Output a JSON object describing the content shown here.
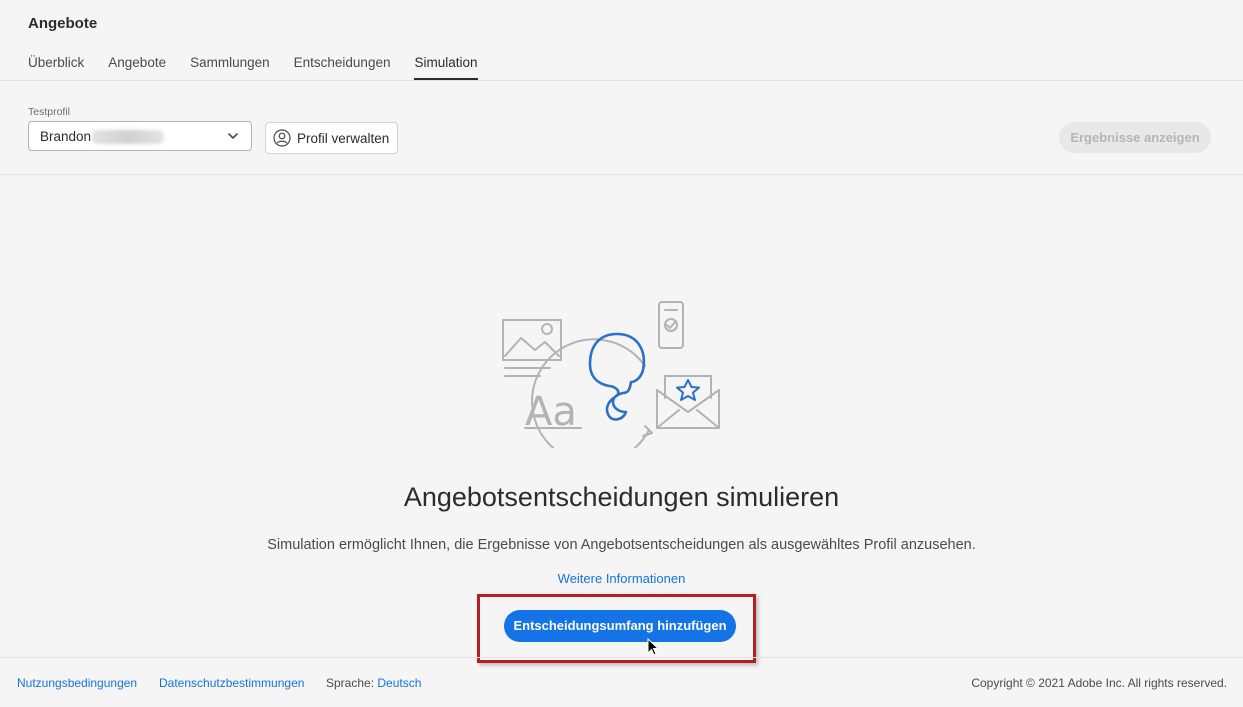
{
  "app": {
    "title": "Angebote"
  },
  "tabs": [
    {
      "label": "Überblick"
    },
    {
      "label": "Angebote"
    },
    {
      "label": "Sammlungen"
    },
    {
      "label": "Entscheidungen"
    },
    {
      "label": "Simulation",
      "active": true
    }
  ],
  "toolbar": {
    "profile_label": "Testprofil",
    "profile_value": "Brandon",
    "manage_label": "Profil verwalten",
    "results_label": "Ergebnisse anzeigen"
  },
  "main": {
    "title": "Angebotsentscheidungen simulieren",
    "description": "Simulation ermöglicht Ihnen, die Ergebnisse von Angebotsentscheidungen als ausgewähltes Profil anzusehen.",
    "learn_more": "Weitere Informationen",
    "cta_label": "Entscheidungsumfang hinzufügen",
    "illustration_text": "Aa"
  },
  "footer": {
    "terms": "Nutzungsbedingungen",
    "privacy": "Datenschutzbestimmungen",
    "language_label": "Sprache:",
    "language_value": "Deutsch",
    "copyright": "Copyright ©  2021 Adobe Inc.  All rights reserved."
  },
  "colors": {
    "accent": "#1473e6",
    "highlight": "#b31f24",
    "illustration_gray": "#b3b3b3",
    "illustration_blue": "#2d70c9"
  },
  "icons": [
    "chevron-down-icon",
    "user-icon",
    "cursor-icon"
  ]
}
